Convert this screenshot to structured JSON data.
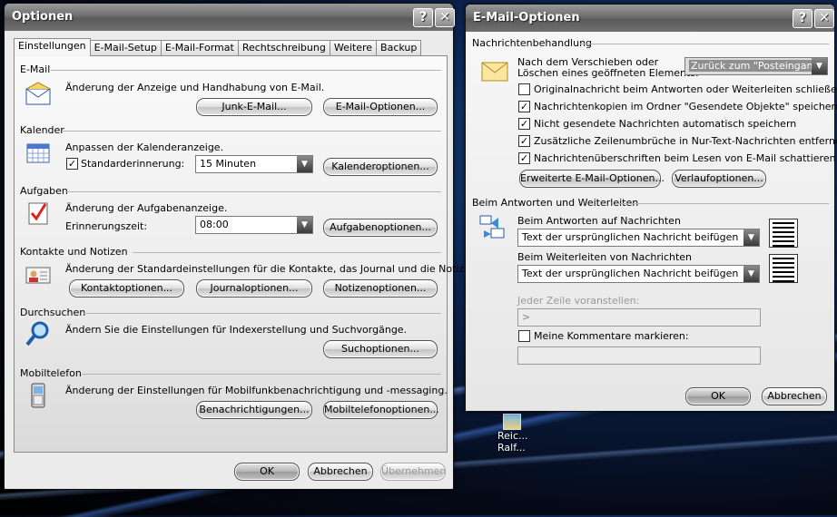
{
  "optionen": {
    "title": "Optionen",
    "help": "?",
    "close": "✕",
    "tabs": [
      "Einstellungen",
      "E-Mail-Setup",
      "E-Mail-Format",
      "Rechtschreibung",
      "Weitere",
      "Backup"
    ],
    "email": {
      "title": "E-Mail",
      "desc": "Änderung der Anzeige und Handhabung von E-Mail.",
      "junk": "Junk-E-Mail...",
      "options": "E-Mail-Optionen..."
    },
    "calendar": {
      "title": "Kalender",
      "desc": "Anpassen der Kalenderanzeige.",
      "reminder_label": "Standarderinnerung:",
      "reminder_value": "15 Minuten",
      "options": "Kalenderoptionen..."
    },
    "tasks": {
      "title": "Aufgaben",
      "desc": "Änderung der Aufgabenanzeige.",
      "time_label": "Erinnerungszeit:",
      "time_value": "08:00",
      "options": "Aufgabenoptionen..."
    },
    "contacts": {
      "title": "Kontakte und Notizen",
      "desc": "Änderung der Standardeinstellungen für die Kontakte, das Journal und die Notizen.",
      "contact_options": "Kontaktoptionen...",
      "journal_options": "Journaloptionen...",
      "note_options": "Notizenoptionen..."
    },
    "search": {
      "title": "Durchsuchen",
      "desc": "Ändern Sie die Einstellungen für Indexerstellung und Suchvorgänge.",
      "options": "Suchoptionen..."
    },
    "mobile": {
      "title": "Mobiltelefon",
      "desc": "Änderung der Einstellungen für Mobilfunkbenachrichtigung und -messaging.",
      "notifications": "Benachrichtigungen...",
      "options": "Mobiltelefonoptionen..."
    },
    "ok": "OK",
    "cancel": "Abbrechen",
    "apply": "Übernehmen"
  },
  "emailoptionen": {
    "title": "E-Mail-Optionen",
    "help": "?",
    "close": "✕",
    "handling": {
      "title": "Nachrichtenbehandlung",
      "after_move_label_1": "Nach dem Verschieben oder",
      "after_move_label_2": "Löschen eines geöffneten Elements:",
      "after_move_value": "Zurück zum \"Posteingang\"",
      "checks": [
        {
          "label": "Originalnachricht beim Antworten oder Weiterleiten schließen",
          "checked": false
        },
        {
          "label": "Nachrichtenkopien im Ordner \"Gesendete Objekte\" speichern",
          "checked": true
        },
        {
          "label": "Nicht gesendete Nachrichten automatisch speichern",
          "checked": true
        },
        {
          "label": "Zusätzliche Zeilenumbrüche in Nur-Text-Nachrichten entfernen",
          "checked": true
        },
        {
          "label": "Nachrichtenüberschriften beim Lesen von E-Mail schattieren",
          "checked": true
        }
      ],
      "advanced": "Erweiterte E-Mail-Optionen...",
      "tracking": "Verlaufoptionen..."
    },
    "reply": {
      "title": "Beim Antworten und Weiterleiten",
      "reply_label": "Beim Antworten auf Nachrichten",
      "reply_value": "Text der ursprünglichen Nachricht beifügen",
      "forward_label": "Beim Weiterleiten von Nachrichten",
      "forward_value": "Text der ursprünglichen Nachricht beifügen",
      "prefix_label": "Jeder Zeile voranstellen:",
      "prefix_value": ">",
      "mark_label": "Meine Kommentare markieren:",
      "mark_checked": false
    },
    "ok": "OK",
    "cancel": "Abbrechen"
  },
  "desktop": {
    "icon_label_1": "Reic...",
    "icon_label_2": "Ralf..."
  },
  "colors": {
    "titlebar": "#6d6d6d",
    "panel": "#ebebeb",
    "desktop": "#0b2450"
  }
}
